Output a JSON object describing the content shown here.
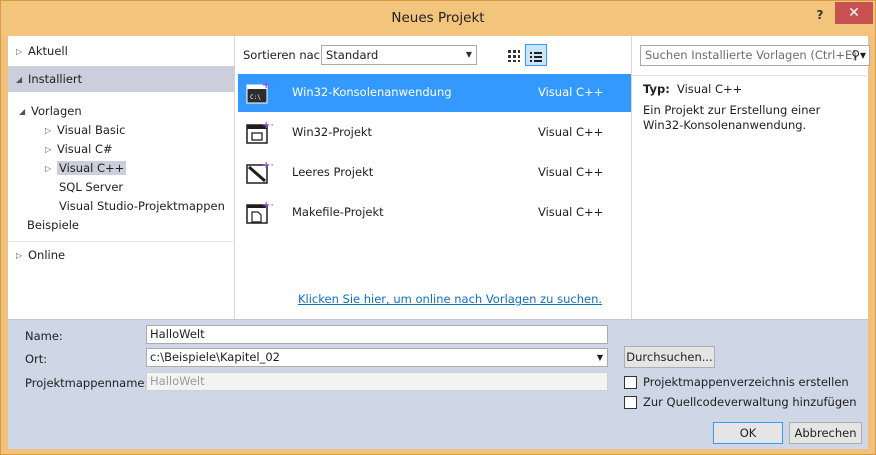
{
  "window": {
    "title": "Neues Projekt",
    "help_label": "?",
    "close_label": "✕"
  },
  "tree": {
    "recent": "Aktuell",
    "installed": "Installiert",
    "templates": "Vorlagen",
    "items": [
      {
        "label": "Visual Basic",
        "expander": true
      },
      {
        "label": "Visual C#",
        "expander": true
      },
      {
        "label": "Visual C++",
        "expander": true,
        "selected": true
      },
      {
        "label": "SQL Server",
        "expander": false
      },
      {
        "label": "Visual Studio-Projektmappen",
        "expander": false
      }
    ],
    "samples": "Beispiele",
    "online": "Online"
  },
  "toolbar": {
    "sort_label": "Sortieren nach:",
    "sort_value": "Standard",
    "search_placeholder": "Suchen Installierte Vorlagen (Ctrl+E)"
  },
  "templates": [
    {
      "name": "Win32-Konsolenanwendung",
      "language": "Visual C++",
      "icon": "console-app-icon",
      "selected": true
    },
    {
      "name": "Win32-Projekt",
      "language": "Visual C++",
      "icon": "win32-project-icon",
      "selected": false
    },
    {
      "name": "Leeres Projekt",
      "language": "Visual C++",
      "icon": "empty-project-icon",
      "selected": false
    },
    {
      "name": "Makefile-Projekt",
      "language": "Visual C++",
      "icon": "makefile-project-icon",
      "selected": false
    }
  ],
  "online_link": "Klicken Sie hier, um online nach Vorlagen zu suchen.",
  "description": {
    "type_label": "Typ:",
    "type_value": "Visual C++",
    "text": "Ein Projekt zur Erstellung einer Win32-Konsolenanwendung."
  },
  "form": {
    "name_label": "Name:",
    "name_value": "HalloWelt",
    "location_label": "Ort:",
    "location_value": "c:\\Beispiele\\Kapitel_02",
    "solution_label": "Projektmappenname:",
    "solution_value": "HalloWelt",
    "browse_label": "Durchsuchen...",
    "create_dir_label": "Projektmappenverzeichnis erstellen",
    "source_control_label": "Zur Quellcodeverwaltung hinzufügen",
    "ok_label": "OK",
    "cancel_label": "Abbrechen"
  },
  "colors": {
    "titlebar": "#f3c47c",
    "selection": "#3399ff",
    "tree_selection": "#cccedb",
    "form_background": "#cfd6e5",
    "close_button": "#c75050",
    "link": "#0e70c0"
  }
}
